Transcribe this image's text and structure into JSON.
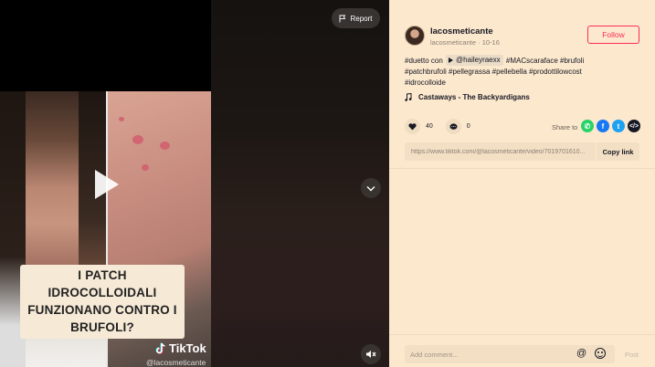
{
  "video": {
    "caption": "I PATCH IDROCOLLOIDALI FUNZIONANO CONTRO I BRUFOLI?",
    "watermark_brand": "TikTok",
    "watermark_user": "@lacosmeticante",
    "report_label": "Report"
  },
  "author": {
    "username": "lacosmeticante",
    "subline": "lacosmeticante · 10-16",
    "follow_label": "Follow"
  },
  "description": {
    "line1_prefix": "#duetto con",
    "mention": "@haileyraexx",
    "line1_suffix": "#MACscaraface #brufoli",
    "line2": "#patchbrufoli #pellegrassa #pellebella #prodottilowcost",
    "line3": "#idrocolloide"
  },
  "music": {
    "title": "Castaways - The Backyardigans"
  },
  "stats": {
    "likes": "40",
    "comments": "0"
  },
  "share": {
    "label": "Share to"
  },
  "link": {
    "url": "https://www.tiktok.com/@lacosmeticante/video/7019701610...",
    "copy_label": "Copy link"
  },
  "comment": {
    "placeholder": "Add comment...",
    "post_label": "Post"
  },
  "colors": {
    "panel_bg": "#fce8cd",
    "accent": "#fe2c55"
  }
}
